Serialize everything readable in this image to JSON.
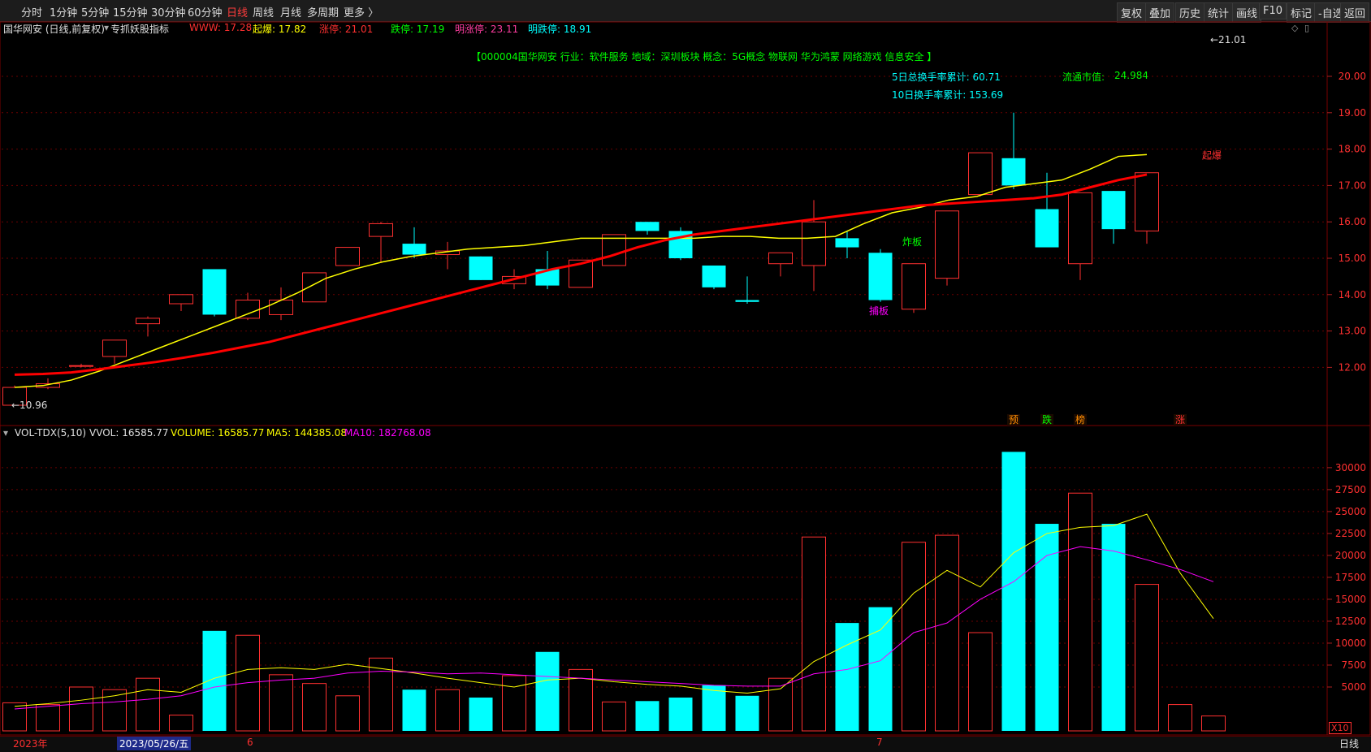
{
  "toolbar": {
    "left_items": [
      {
        "label": "分时",
        "active": false
      },
      {
        "label": "1分钟",
        "active": false
      },
      {
        "label": "5分钟",
        "active": false
      },
      {
        "label": "15分钟",
        "active": false
      },
      {
        "label": "30分钟",
        "active": false
      },
      {
        "label": "60分钟",
        "active": false
      },
      {
        "label": "日线",
        "active": true
      },
      {
        "label": "周线",
        "active": false
      },
      {
        "label": "月线",
        "active": false
      },
      {
        "label": "多周期",
        "active": false
      },
      {
        "label": "更多 〉",
        "active": false
      }
    ],
    "right_items": [
      "复权",
      "叠加",
      "历史",
      "统计",
      "画线",
      "F10",
      "标记",
      "-自选",
      "返回"
    ]
  },
  "header": {
    "stock_label": "国华网安 (日线,前复权)",
    "indicator_label": "专抓妖股指标",
    "values": [
      {
        "label": "WWW: 17.28",
        "color": "#ff3030"
      },
      {
        "label": "起爆: 17.82",
        "color": "#ffff00"
      },
      {
        "label": "涨停: 21.01",
        "color": "#ff3030"
      },
      {
        "label": "跌停: 17.19",
        "color": "#00ff00"
      },
      {
        "label": "明涨停: 23.11",
        "color": "#ff3da0"
      },
      {
        "label": "明跌停: 18.91",
        "color": "#00ffff"
      }
    ],
    "info_line": "【000004国华网安  行业：软件服务  地域：深圳板块  概念：5G概念 物联网 华为鸿蒙 网络游戏 信息安全 】",
    "turnover5": "5日总换手率累计: 60.71",
    "turnover10": "10日换手率累计: 153.69",
    "market_cap_label": "流通市值:",
    "market_cap_value": "24.984"
  },
  "volume_header": {
    "name": "VOL-TDX(5,10)",
    "vvol": "VVOL: 16585.77",
    "volume": "VOLUME: 16585.77",
    "ma5": "MA5: 144385.08",
    "ma10": "MA10: 182768.08"
  },
  "bottom": {
    "year_label": "2023年",
    "selected_date": "2023/05/26/五",
    "month6": "6",
    "month7": "7",
    "zoom_label": "X10",
    "period_label": "日线"
  },
  "colors": {
    "up": "#ff3030",
    "down": "#00ffff",
    "ma_yellow": "#ffff00",
    "ma_red": "#ff0000",
    "vol_ma5": "#ffff00",
    "vol_ma10": "#ff00ff"
  },
  "chart_data": [
    {
      "type": "candlestick",
      "title": "国华网安 (日线,前复权)",
      "ylim": [
        11.0,
        21.5
      ],
      "y_ticks": [
        12.0,
        13.0,
        14.0,
        15.0,
        16.0,
        17.0,
        18.0,
        19.0,
        20.0
      ],
      "candles": [
        {
          "o": 10.96,
          "c": 11.45,
          "h": 11.5,
          "l": 10.96
        },
        {
          "o": 11.45,
          "c": 11.55,
          "h": 11.7,
          "l": 11.4
        },
        {
          "o": 12.05,
          "c": 12.05,
          "h": 12.1,
          "l": 12.0
        },
        {
          "o": 12.3,
          "c": 12.75,
          "h": 12.75,
          "l": 12.1
        },
        {
          "o": 13.2,
          "c": 13.35,
          "h": 13.4,
          "l": 12.85
        },
        {
          "o": 13.75,
          "c": 14.0,
          "h": 14.0,
          "l": 13.55
        },
        {
          "o": 14.7,
          "c": 13.45,
          "h": 14.7,
          "l": 13.4
        },
        {
          "o": 13.35,
          "c": 13.85,
          "h": 14.05,
          "l": 13.3
        },
        {
          "o": 13.45,
          "c": 13.85,
          "h": 14.2,
          "l": 13.3
        },
        {
          "o": 13.8,
          "c": 14.6,
          "h": 14.6,
          "l": 13.8
        },
        {
          "o": 14.8,
          "c": 15.3,
          "h": 15.3,
          "l": 14.8
        },
        {
          "o": 15.6,
          "c": 15.95,
          "h": 16.0,
          "l": 14.9
        },
        {
          "o": 15.4,
          "c": 15.1,
          "h": 15.85,
          "l": 15.0
        },
        {
          "o": 15.1,
          "c": 15.2,
          "h": 15.45,
          "l": 14.7
        },
        {
          "o": 15.05,
          "c": 14.4,
          "h": 15.05,
          "l": 14.4
        },
        {
          "o": 14.3,
          "c": 14.5,
          "h": 14.7,
          "l": 14.15
        },
        {
          "o": 14.7,
          "c": 14.25,
          "h": 15.2,
          "l": 14.15
        },
        {
          "o": 14.2,
          "c": 14.95,
          "h": 14.95,
          "l": 14.2
        },
        {
          "o": 14.8,
          "c": 15.65,
          "h": 15.65,
          "l": 14.8
        },
        {
          "o": 16.0,
          "c": 15.75,
          "h": 16.0,
          "l": 15.65
        },
        {
          "o": 15.75,
          "c": 15.0,
          "h": 15.85,
          "l": 14.95
        },
        {
          "o": 14.8,
          "c": 14.2,
          "h": 14.8,
          "l": 14.15
        },
        {
          "o": 13.85,
          "c": 13.8,
          "h": 14.5,
          "l": 13.75
        },
        {
          "o": 14.85,
          "c": 15.15,
          "h": 15.15,
          "l": 14.5
        },
        {
          "o": 14.8,
          "c": 16.0,
          "h": 16.6,
          "l": 14.1
        },
        {
          "o": 15.55,
          "c": 15.3,
          "h": 15.75,
          "l": 15.0
        },
        {
          "o": 15.15,
          "c": 13.85,
          "h": 15.25,
          "l": 13.8
        },
        {
          "o": 13.6,
          "c": 14.85,
          "h": 14.85,
          "l": 13.5
        },
        {
          "o": 14.45,
          "c": 16.3,
          "h": 16.3,
          "l": 14.25
        },
        {
          "o": 16.75,
          "c": 17.9,
          "h": 17.9,
          "l": 16.7
        },
        {
          "o": 17.75,
          "c": 17.0,
          "h": 19.0,
          "l": 16.9
        },
        {
          "o": 16.35,
          "c": 15.3,
          "h": 17.35,
          "l": 15.3
        },
        {
          "o": 14.85,
          "c": 16.8,
          "h": 16.8,
          "l": 14.4
        },
        {
          "o": 16.85,
          "c": 15.8,
          "h": 16.85,
          "l": 15.4
        },
        {
          "o": 15.75,
          "c": 17.35,
          "h": 17.35,
          "l": 15.4
        }
      ],
      "ma_yellow": [
        11.45,
        11.5,
        11.65,
        11.9,
        12.2,
        12.5,
        12.8,
        13.1,
        13.4,
        13.7,
        14.05,
        14.45,
        14.7,
        14.9,
        15.05,
        15.15,
        15.25,
        15.3,
        15.35,
        15.45,
        15.55,
        15.55,
        15.55,
        15.55,
        15.55,
        15.6,
        15.6,
        15.55,
        15.55,
        15.6,
        15.95,
        16.25,
        16.4,
        16.6,
        16.7,
        16.95,
        17.05,
        17.15,
        17.45,
        17.8,
        17.85
      ],
      "ma_red": [
        11.8,
        11.82,
        11.86,
        11.95,
        12.05,
        12.15,
        12.27,
        12.4,
        12.55,
        12.7,
        12.9,
        13.1,
        13.3,
        13.5,
        13.7,
        13.9,
        14.1,
        14.3,
        14.5,
        14.7,
        14.85,
        15.05,
        15.3,
        15.5,
        15.65,
        15.75,
        15.85,
        15.95,
        16.05,
        16.15,
        16.25,
        16.35,
        16.45,
        16.5,
        16.55,
        16.6,
        16.65,
        16.75,
        16.95,
        17.15,
        17.3
      ],
      "annotations": [
        {
          "text": "←10.96",
          "idx": 0,
          "value": 10.96,
          "color": "#dddddd"
        },
        {
          "text": "←21.01",
          "idx": 36,
          "value": 21.01,
          "color": "#dddddd"
        },
        {
          "text": "炸板",
          "idx": 27,
          "value": 15.45,
          "color": "#00ff00"
        },
        {
          "text": "捕板",
          "idx": 26,
          "value": 13.55,
          "color": "#ff00ff"
        },
        {
          "text": "起爆",
          "idx": 36,
          "value": 17.82,
          "color": "#ff3030"
        }
      ],
      "markers": [
        {
          "text": "预",
          "idx": 30,
          "color": "#ff8c00"
        },
        {
          "text": "跌",
          "idx": 31,
          "color": "#00ff00"
        },
        {
          "text": "榜",
          "idx": 32,
          "color": "#ff8c00"
        },
        {
          "text": "涨",
          "idx": 35,
          "color": "#ff3030"
        }
      ]
    },
    {
      "type": "bar",
      "title": "VOL-TDX(5,10)",
      "ylim": [
        0,
        32000
      ],
      "y_ticks": [
        5000,
        7500,
        10000,
        12500,
        15000,
        17500,
        20000,
        22500,
        25000,
        27500,
        30000
      ],
      "values": [
        3200,
        3000,
        5000,
        4700,
        6000,
        1800,
        11400,
        10900,
        6400,
        5400,
        4000,
        8300,
        4700,
        4700,
        3800,
        6300,
        9000,
        7000,
        3300,
        3400,
        3800,
        5200,
        4000,
        6000,
        22100,
        12300,
        14100,
        21500,
        22300,
        11200,
        31800,
        23600,
        27100,
        23600,
        16700,
        3000,
        1700
      ],
      "direction": [
        "up",
        "up",
        "up",
        "up",
        "up",
        "up",
        "down",
        "up",
        "up",
        "up",
        "up",
        "up",
        "down",
        "up",
        "down",
        "up",
        "down",
        "up",
        "up",
        "down",
        "down",
        "down",
        "down",
        "up",
        "up",
        "down",
        "down",
        "up",
        "up",
        "up",
        "down",
        "down",
        "up",
        "down",
        "up",
        "up",
        "up"
      ],
      "ma5": [
        2800,
        3100,
        3500,
        4000,
        4700,
        4400,
        6000,
        7000,
        7200,
        7000,
        7600,
        7100,
        6600,
        6000,
        5500,
        5000,
        5800,
        6000,
        5600,
        5300,
        5100,
        4600,
        4300,
        4800,
        7900,
        9800,
        11500,
        15700,
        18300,
        16400,
        20300,
        22500,
        23200,
        23400,
        24700,
        18000,
        12800
      ],
      "ma10": [
        2500,
        2800,
        3100,
        3300,
        3600,
        4000,
        5000,
        5500,
        5800,
        6000,
        6600,
        6800,
        6700,
        6500,
        6600,
        6400,
        6200,
        6000,
        5800,
        5600,
        5400,
        5200,
        5100,
        5100,
        6500,
        7000,
        8000,
        11200,
        12300,
        15000,
        17000,
        20000,
        21000,
        20500,
        19500,
        18400,
        17000
      ]
    }
  ]
}
